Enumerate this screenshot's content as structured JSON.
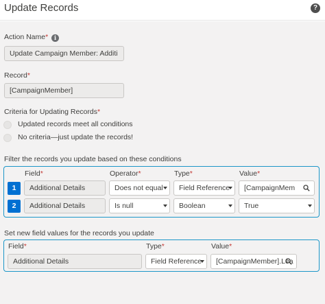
{
  "header": {
    "title": "Update Records",
    "help_glyph": "?"
  },
  "action_name": {
    "label": "Action Name",
    "required_mark": "*",
    "info_glyph": "i",
    "value": "Update Campaign Member: Additi"
  },
  "record": {
    "label": "Record",
    "required_mark": "*",
    "value": "[CampaignMember]"
  },
  "criteria": {
    "label": "Criteria for Updating Records",
    "required_mark": "*",
    "options": [
      {
        "label": "Updated records meet all conditions"
      },
      {
        "label": "No criteria—just update the records!"
      }
    ]
  },
  "filter": {
    "heading": "Filter the records you update based on these conditions",
    "columns": {
      "field": "Field",
      "operator": "Operator",
      "type": "Type",
      "value": "Value"
    },
    "required_mark": "*",
    "rows": [
      {
        "num": "1",
        "field": "Additional Details",
        "operator": "Does not equal",
        "type": "Field Reference",
        "value": "[CampaignMem"
      },
      {
        "num": "2",
        "field": "Additional Details",
        "operator": "Is null",
        "type": "Boolean",
        "value": "True"
      }
    ]
  },
  "set_values": {
    "heading": "Set new field values for the records you update",
    "columns": {
      "field": "Field",
      "type": "Type",
      "value": "Value"
    },
    "required_mark": "*",
    "row": {
      "field": "Additional Details",
      "type": "Field Reference",
      "value": "[CampaignMember].Lea"
    }
  },
  "icons": {
    "help": "question-circle-icon",
    "info": "info-icon",
    "search": "search-icon",
    "dropdown": "chevron-down-icon"
  },
  "colors": {
    "accent_border": "#1b96c8",
    "number_badge": "#0070d2",
    "required": "#c23934",
    "panel_bg": "#f3f2f2"
  }
}
